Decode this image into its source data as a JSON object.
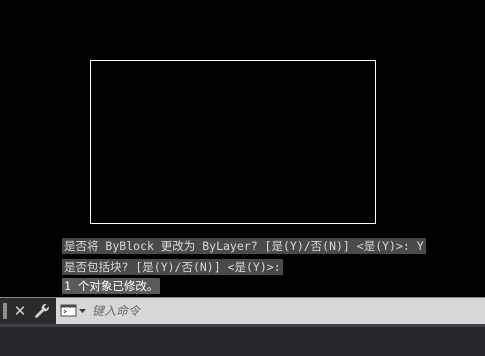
{
  "command_history": [
    "是否将 ByBlock 更改为 ByLayer? [是(Y)/否(N)] <是(Y)>: Y",
    "是否包括块? [是(Y)/否(N)] <是(Y)>:",
    "1 个对象已修改。"
  ],
  "command_line": {
    "placeholder": "键入命令",
    "value": ""
  },
  "icons": {
    "close": "close-icon",
    "customize": "wrench-icon",
    "prompt": "command-prompt-icon",
    "grip": "grip-handle-icon"
  },
  "colors": {
    "canvas": "#000000",
    "rectangle_stroke": "#ffffff",
    "command_bar": "#d7d7d7",
    "history_bg": "#4a4a4a"
  }
}
